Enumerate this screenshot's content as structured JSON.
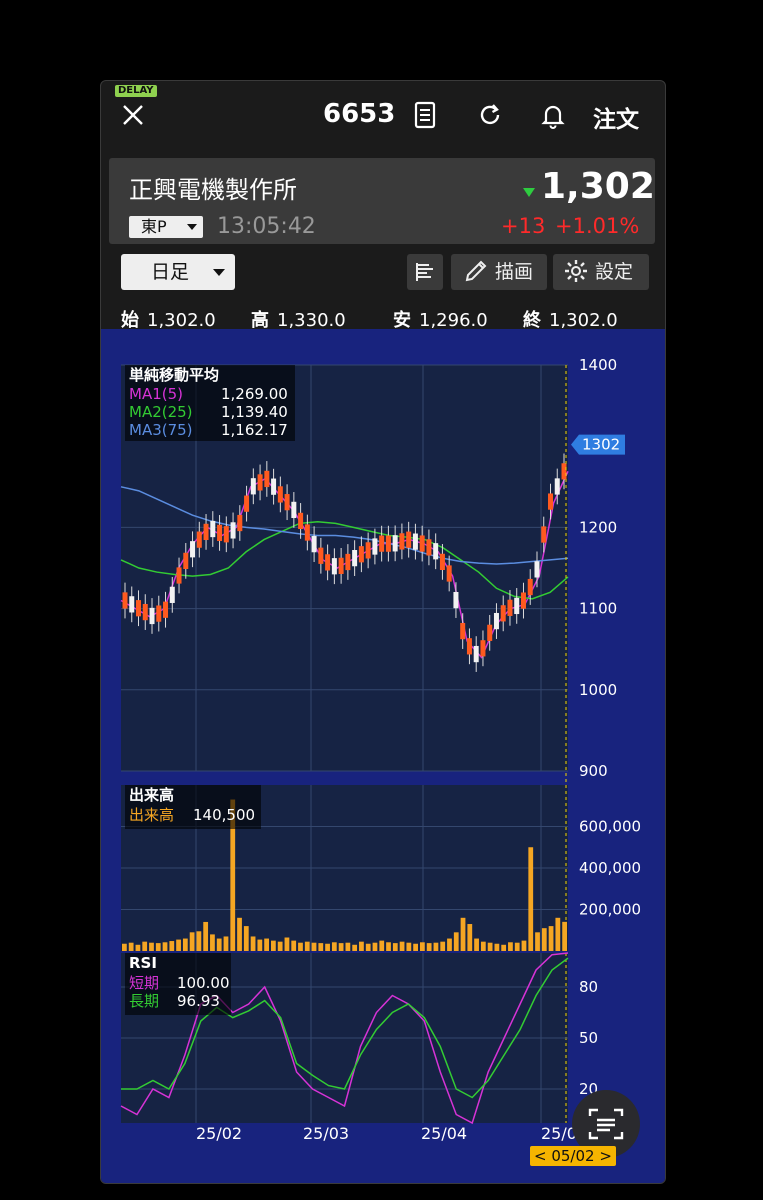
{
  "delay_label": "DELAY",
  "toolbar": {
    "code": "6653",
    "order_label": "注文"
  },
  "quote": {
    "name": "正興電機製作所",
    "exchange": "東P",
    "time": "13:05:42",
    "price": "1,302",
    "change": "+13",
    "change_pct": "+1.01%"
  },
  "controls": {
    "period": "日足",
    "draw_label": "描画",
    "settings_label": "設定"
  },
  "ohlc": {
    "open_label": "始",
    "open": "1,302.0",
    "high_label": "高",
    "high": "1,330.0",
    "low_label": "安",
    "low": "1,296.0",
    "close_label": "終",
    "close": "1,302.0"
  },
  "chart_data": [
    {
      "type": "line",
      "title": "単純移動平均",
      "ylim": [
        900,
        1400
      ],
      "yticks": [
        1400,
        1200,
        1100,
        1000,
        900
      ],
      "price_tag": "1302",
      "series": [
        {
          "name": "MA1(5)",
          "value": "1,269.00",
          "color": "#d633d6",
          "values": [
            1110,
            1100,
            1090,
            1100,
            1150,
            1180,
            1200,
            1190,
            1200,
            1250,
            1260,
            1240,
            1220,
            1190,
            1160,
            1150,
            1160,
            1170,
            1180,
            1180,
            1185,
            1180,
            1170,
            1140,
            1060,
            1040,
            1080,
            1100,
            1105,
            1140,
            1230,
            1269
          ]
        },
        {
          "name": "MA2(25)",
          "value": "1,139.40",
          "color": "#33cc33",
          "values": [
            1160,
            1150,
            1145,
            1142,
            1140,
            1142,
            1150,
            1170,
            1185,
            1195,
            1205,
            1207,
            1205,
            1200,
            1195,
            1190,
            1188,
            1185,
            1175,
            1160,
            1145,
            1125,
            1115,
            1112,
            1120,
            1139
          ]
        },
        {
          "name": "MA3(75)",
          "value": "1,162.17",
          "color": "#5b8de0",
          "values": [
            1250,
            1245,
            1235,
            1225,
            1215,
            1208,
            1203,
            1200,
            1198,
            1195,
            1192,
            1190,
            1190,
            1188,
            1185,
            1180,
            1175,
            1168,
            1162,
            1158,
            1156,
            1155,
            1156,
            1158,
            1160,
            1162
          ]
        }
      ]
    },
    {
      "type": "bar",
      "title": "出来高",
      "series": [
        {
          "name": "出来高",
          "value": "140,500",
          "color": "#f5a623"
        }
      ],
      "ylim": [
        0,
        800000
      ],
      "yticks": [
        "600,000",
        "400,000",
        "200,000"
      ],
      "values": [
        35000,
        40000,
        30000,
        45000,
        40000,
        38000,
        42000,
        48000,
        55000,
        60000,
        90000,
        95000,
        140000,
        80000,
        60000,
        70000,
        730000,
        160000,
        120000,
        70000,
        55000,
        60000,
        50000,
        45000,
        65000,
        50000,
        40000,
        45000,
        40000,
        38000,
        35000,
        42000,
        38000,
        40000,
        30000,
        45000,
        35000,
        40000,
        50000,
        42000,
        38000,
        45000,
        40000,
        35000,
        42000,
        38000,
        40000,
        45000,
        60000,
        90000,
        160000,
        130000,
        60000,
        45000,
        40000,
        35000,
        30000,
        42000,
        40000,
        50000,
        500000,
        90000,
        110000,
        120000,
        160000,
        140500
      ]
    },
    {
      "type": "line",
      "title": "RSI",
      "ylim": [
        0,
        100
      ],
      "yticks": [
        80,
        50,
        20
      ],
      "series": [
        {
          "name": "短期",
          "value": "100.00",
          "color": "#d633d6"
        },
        {
          "name": "長期",
          "value": "96.93",
          "color": "#33cc33"
        }
      ]
    }
  ],
  "x_labels": [
    "25/02",
    "25/03",
    "25/04",
    "25/0"
  ],
  "date_tag": "< 05/02 >"
}
